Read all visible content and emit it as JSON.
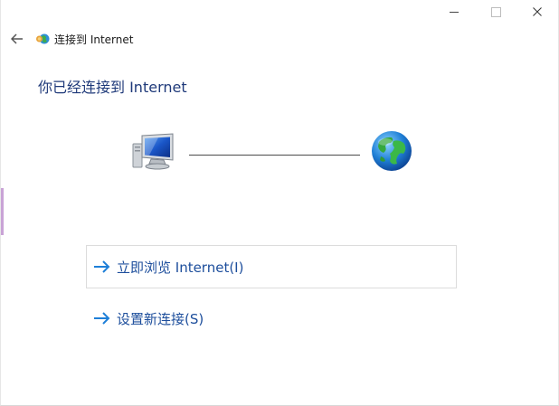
{
  "window": {
    "title": "连接到 Internet",
    "caption_icons": [
      "minimize-icon",
      "maximize-icon",
      "close-icon"
    ]
  },
  "header": {
    "back_icon": "back-arrow-icon",
    "app_icon": "network-connection-icon",
    "title": "连接到 Internet"
  },
  "main": {
    "heading": "你已经连接到 Internet",
    "illustration": {
      "left_icon": "computer-monitor-icon",
      "right_icon": "globe-icon"
    },
    "links": [
      {
        "label": "立即浏览 Internet(I)",
        "icon": "arrow-right-icon",
        "focused": true
      },
      {
        "label": "设置新连接(S)",
        "icon": "arrow-right-icon",
        "focused": false
      }
    ]
  },
  "colors": {
    "heading": "#1f3a7a",
    "link": "#1d4e9c",
    "arrow": "#1e7fd8",
    "accent": "#c9a3d6"
  }
}
